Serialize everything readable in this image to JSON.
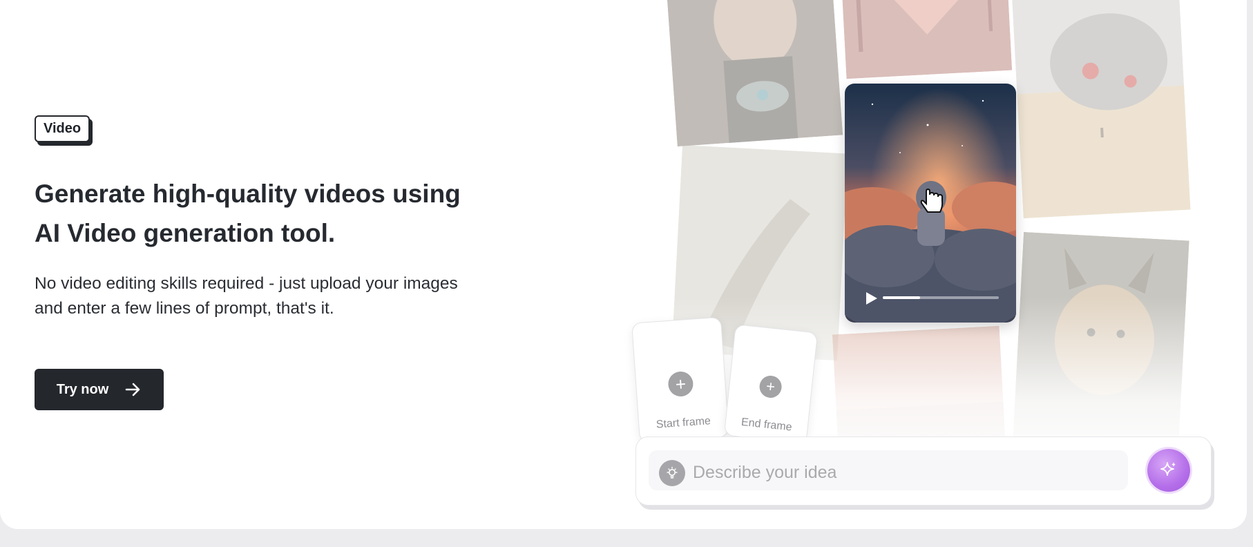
{
  "hero": {
    "badge": "Video",
    "headline": "Generate high-quality videos using AI Video generation tool.",
    "subtext": "No video editing skills required - just upload your images and enter a few lines of prompt, that's it.",
    "cta_label": "Try now"
  },
  "collage": {
    "images": [
      "portrait-woman",
      "painted-hand",
      "robot-head-desert",
      "foggy-hand",
      "lynx",
      "sunset-landscape"
    ]
  },
  "video_preview": {
    "progress": 0.32
  },
  "frames": {
    "start_label": "Start frame",
    "end_label": "End frame"
  },
  "prompt": {
    "placeholder": "Describe your idea"
  },
  "colors": {
    "dark": "#24272c",
    "accent": "#b46ee9"
  },
  "icons": {
    "arrow": "arrow-right-icon",
    "plus": "plus-icon",
    "bulb": "lightbulb-icon",
    "sparkle": "sparkle-icon",
    "play": "play-icon",
    "cursor": "hand-cursor-icon"
  }
}
